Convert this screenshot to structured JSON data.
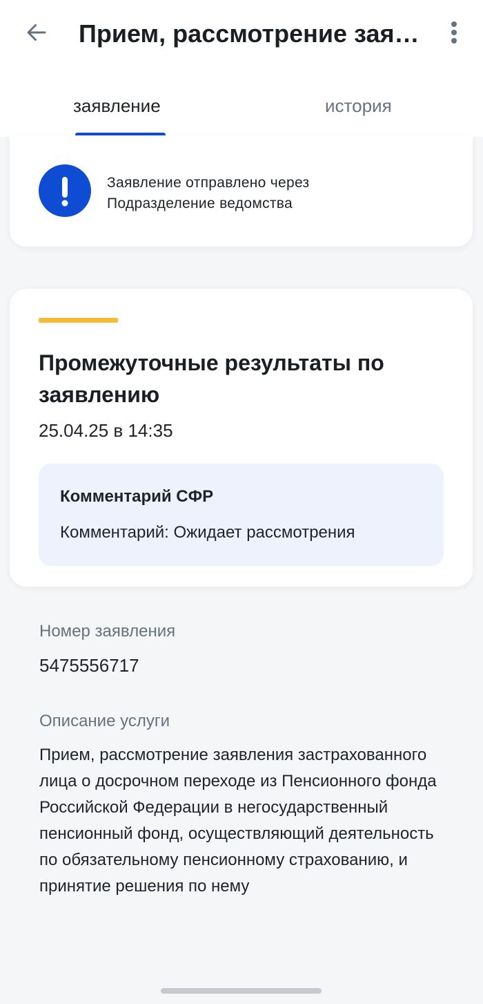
{
  "header": {
    "back_icon": "arrow-left-icon",
    "title": "Прием, рассмотрение заявления застрахованного лица о досрочном переходе",
    "menu_icon": "more-vertical-icon"
  },
  "tabs": [
    {
      "label": "заявление",
      "active": true
    },
    {
      "label": "история",
      "active": false
    }
  ],
  "notice": {
    "icon": "exclamation-icon",
    "line1": "Заявление отправлено через",
    "line2": "Подразделение ведомства"
  },
  "results": {
    "title": "Промежуточные результаты по заявлению",
    "date": "25.04.25 в 14:35",
    "comment_title": "Комментарий СФР",
    "comment_text": "Комментарий: Ожидает рассмотрения"
  },
  "details": {
    "number_label": "Номер заявления",
    "number_value": "5475556717",
    "description_label": "Описание услуги",
    "description_value": "Прием, рассмотрение заявления застрахованного лица о досрочном переходе из Пенсионного фонда Российской Федерации в негосударственный пенсионный фонд, осуществляющий деятельность по обязательному пенсионному страхованию, и принятие решения по нему"
  },
  "colors": {
    "accent_blue": "#0d4cd3",
    "accent_yellow": "#f6bb31",
    "comment_bg": "#edf2fd",
    "muted_text": "#66727f"
  }
}
